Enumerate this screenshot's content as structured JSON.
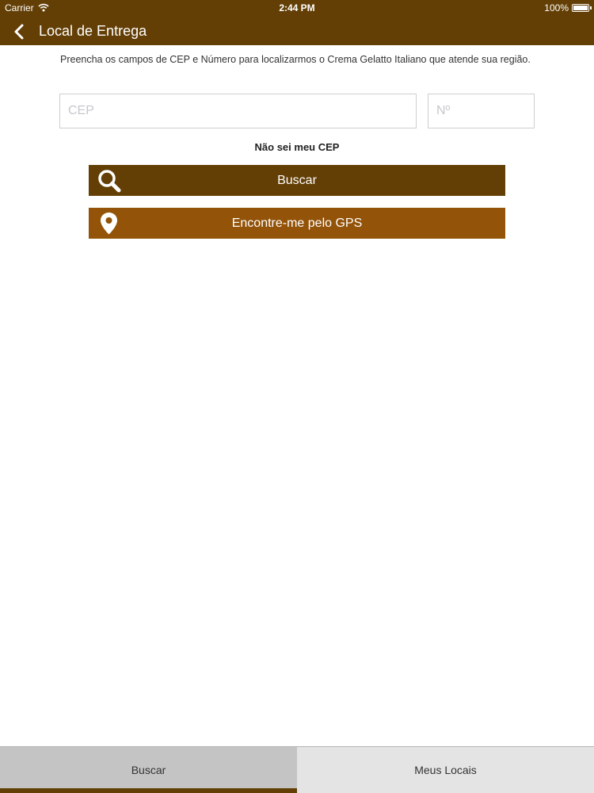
{
  "status_bar": {
    "carrier": "Carrier",
    "time": "2:44 PM",
    "battery": "100%"
  },
  "header": {
    "title": "Local de Entrega",
    "back_icon": "chevron-left-icon",
    "background_color": "#633f06"
  },
  "form": {
    "instructions": "Preencha os campos de CEP e Número para localizarmos o Crema Gelatto Italiano que atende sua região.",
    "cep": {
      "value": "",
      "placeholder": "CEP"
    },
    "number": {
      "value": "",
      "placeholder": "Nº"
    },
    "no_cep_link": "Não sei meu CEP"
  },
  "buttons": {
    "search": {
      "label": "Buscar",
      "icon": "search-icon",
      "color": "#633f06"
    },
    "gps": {
      "label": "Encontre-me pelo GPS",
      "icon": "location-pin-icon",
      "color": "#935309"
    }
  },
  "tab_bar": {
    "selected": "Buscar",
    "tabs": [
      {
        "label": "Buscar"
      },
      {
        "label": "Meus Locais"
      }
    ]
  }
}
